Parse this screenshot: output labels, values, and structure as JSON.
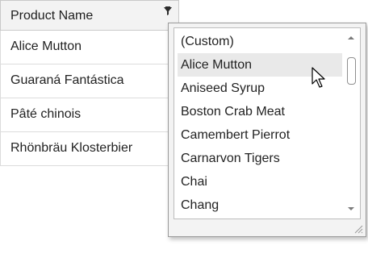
{
  "grid": {
    "column_header": "Product Name",
    "rows": [
      "Alice Mutton",
      "Guaraná Fantástica",
      "Pâté chinois",
      "Rhönbräu Klosterbier"
    ]
  },
  "filter_popup": {
    "items": [
      "(Custom)",
      "Alice Mutton",
      "Aniseed Syrup",
      "Boston Crab Meat",
      "Camembert Pierrot",
      "Carnarvon Tigers",
      "Chai",
      "Chang"
    ],
    "hovered_item": "Alice Mutton"
  },
  "icons": {
    "filter": "filter-icon",
    "scroll_up": "scroll-up-arrow-icon",
    "scroll_down": "scroll-down-arrow-icon",
    "resize_grip": "resize-grip-icon",
    "cursor": "mouse-pointer-icon"
  },
  "colors": {
    "header_bg": "#f3f3f3",
    "hover_bg": "#e9e9e9",
    "border": "#c9c9c9"
  }
}
